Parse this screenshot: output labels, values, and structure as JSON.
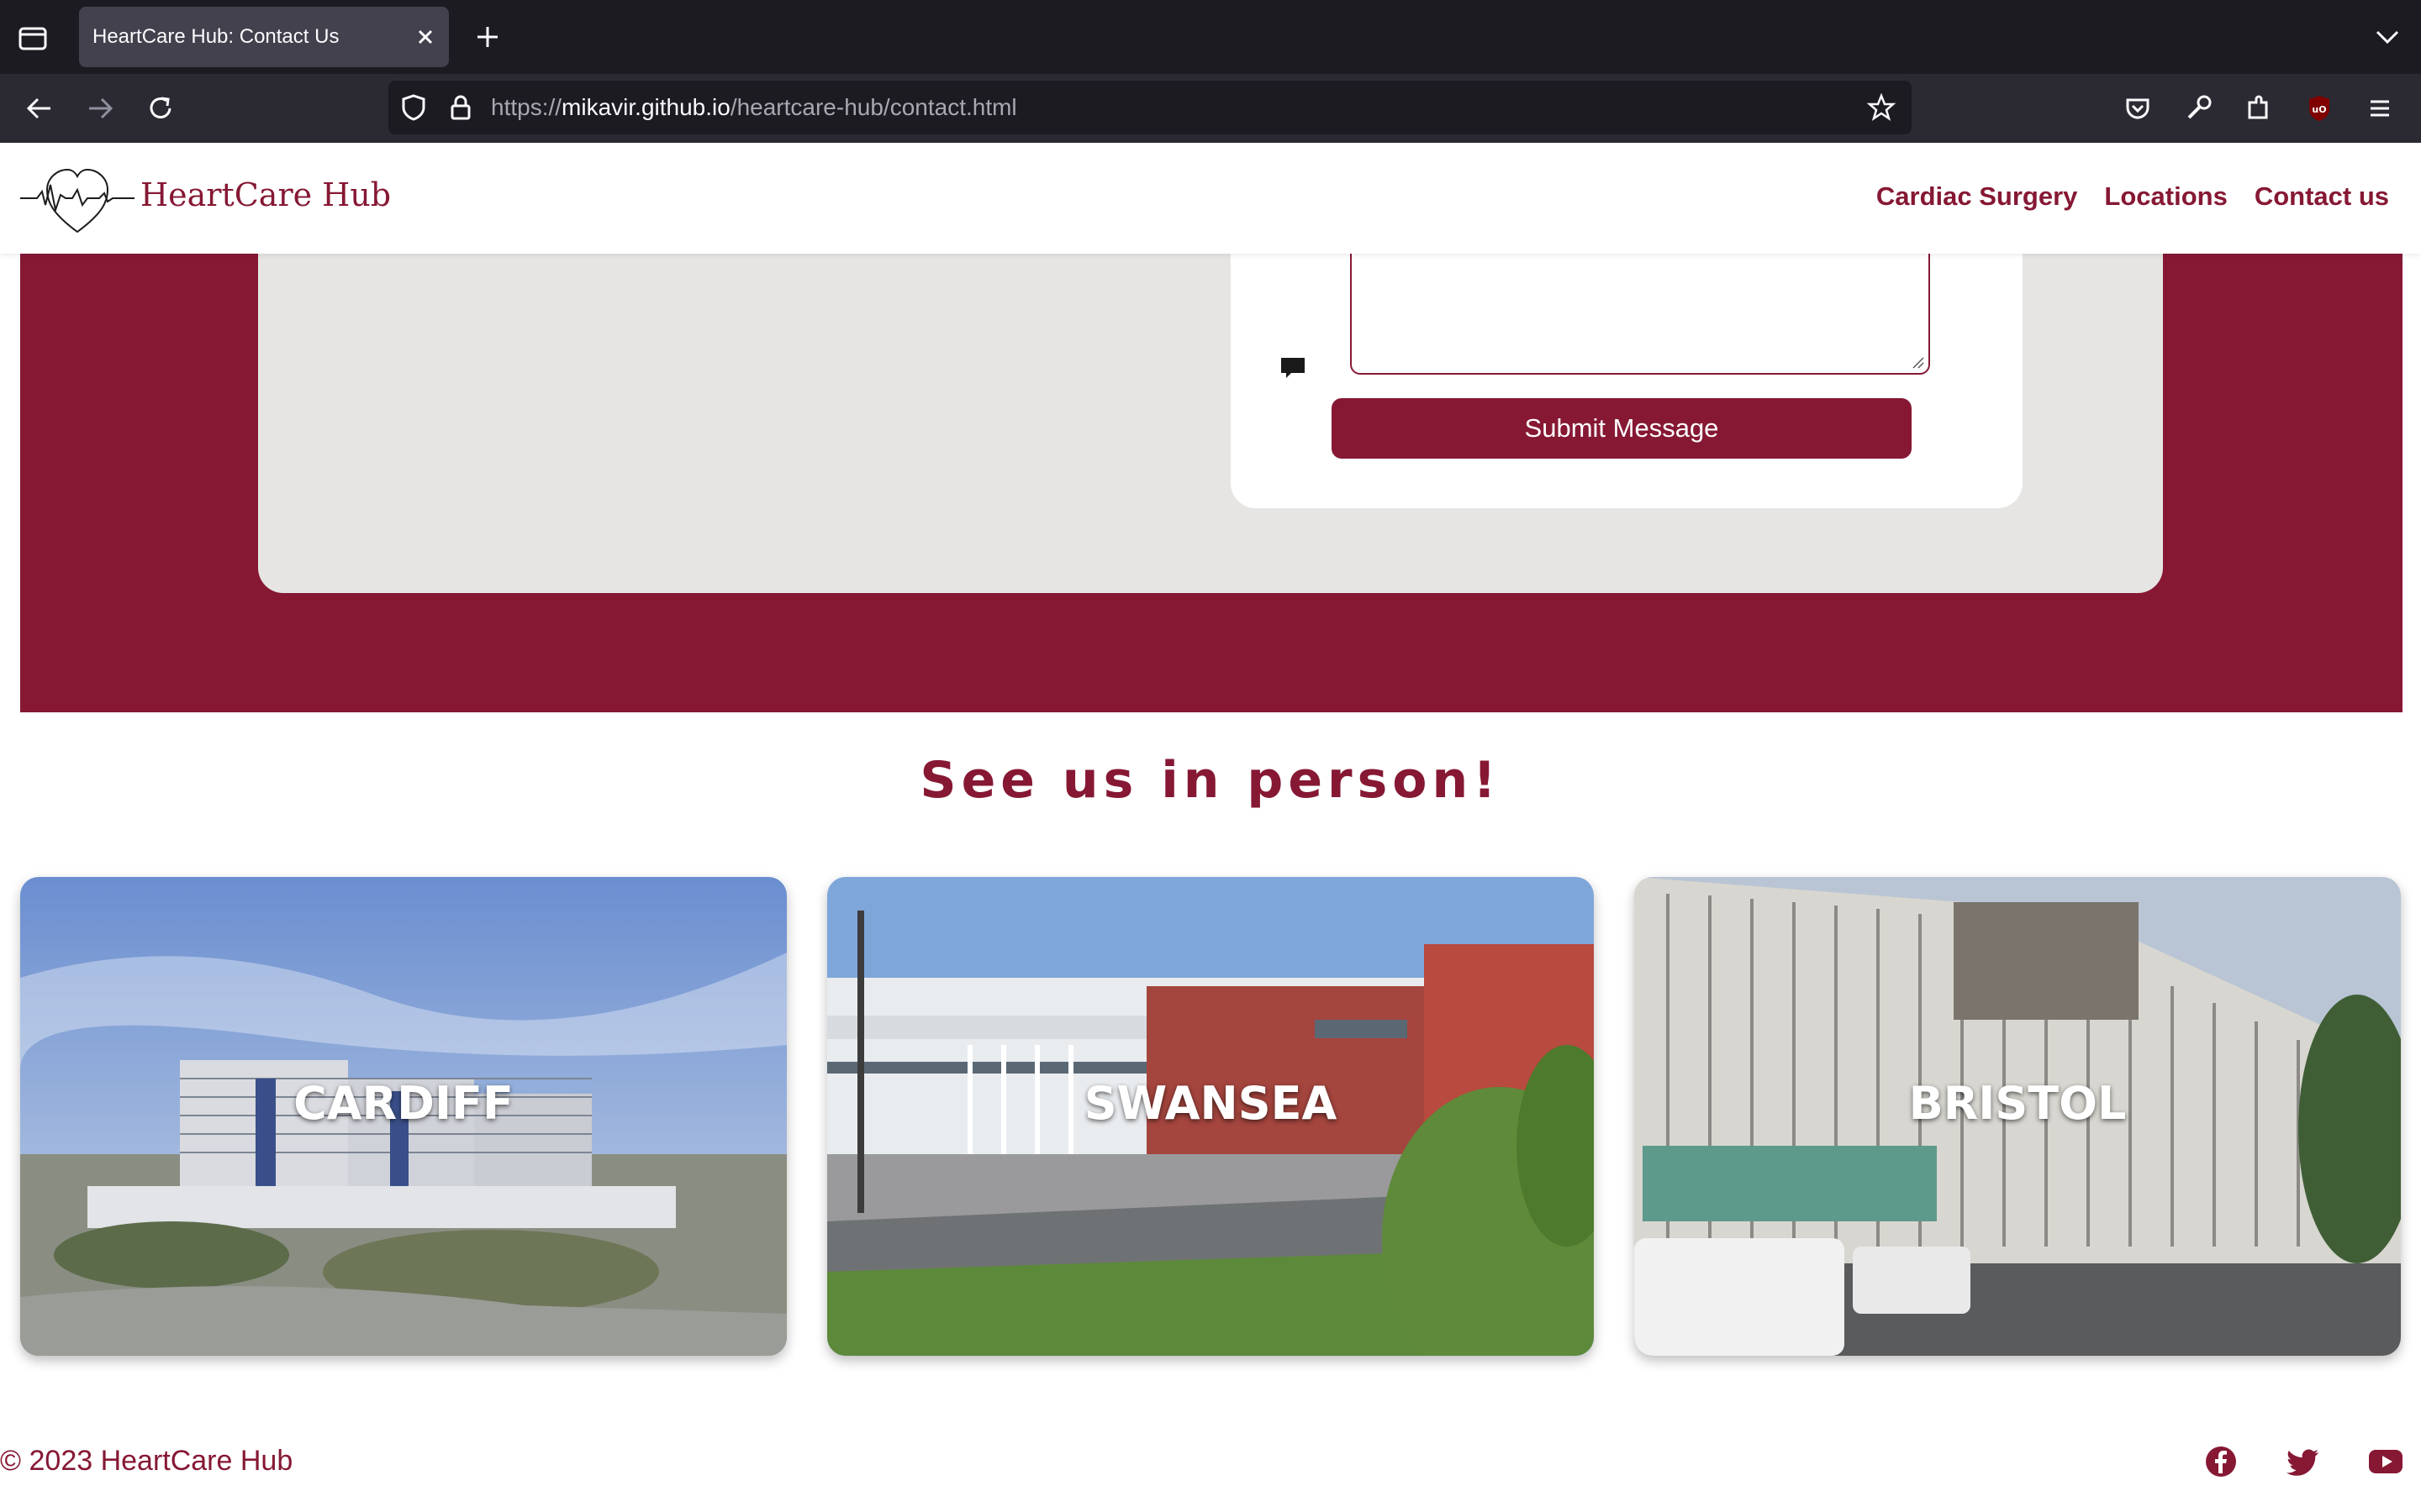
{
  "browser": {
    "tab_title": "HeartCare Hub: Contact Us",
    "url_scheme": "https://",
    "url_host": "mikavir.github.io",
    "url_path": "/heartcare-hub/contact.html"
  },
  "site": {
    "brand": "HeartCare Hub",
    "nav": [
      "Cardiac Surgery",
      "Locations",
      "Contact us"
    ],
    "accent_color": "#861834"
  },
  "contact_form": {
    "message_value": "",
    "submit_label": "Submit Message"
  },
  "locations": {
    "heading": "See us in person!",
    "cards": [
      "CARDIFF",
      "SWANSEA",
      "BRISTOL"
    ]
  },
  "footer": {
    "copyright": "© 2023 HeartCare Hub",
    "social_icons": [
      "facebook-icon",
      "twitter-icon",
      "youtube-icon"
    ]
  }
}
